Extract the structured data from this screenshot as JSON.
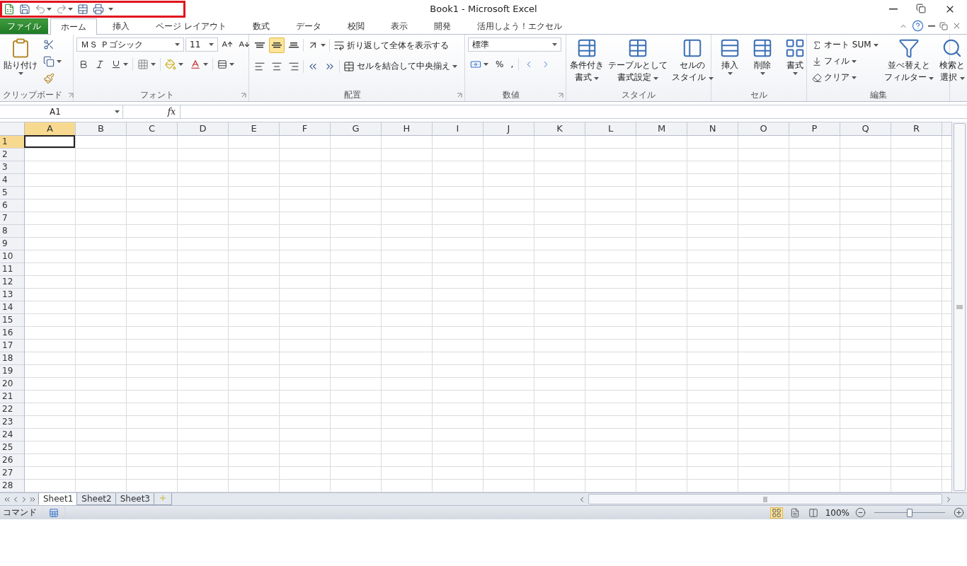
{
  "window": {
    "title": "Book1 - Microsoft Excel"
  },
  "quick_access": {
    "highlighted": true
  },
  "ribbon_tabs": [
    {
      "label": "ファイル",
      "kind": "file",
      "selected": false
    },
    {
      "label": "ホーム",
      "kind": "tab",
      "selected": true
    },
    {
      "label": "挿入",
      "kind": "tab",
      "selected": false
    },
    {
      "label": "ページ レイアウト",
      "kind": "tab",
      "selected": false
    },
    {
      "label": "数式",
      "kind": "tab",
      "selected": false
    },
    {
      "label": "データ",
      "kind": "tab",
      "selected": false
    },
    {
      "label": "校閲",
      "kind": "tab",
      "selected": false
    },
    {
      "label": "表示",
      "kind": "tab",
      "selected": false
    },
    {
      "label": "開発",
      "kind": "tab",
      "selected": false
    },
    {
      "label": "活用しよう！エクセル",
      "kind": "tab",
      "selected": false
    }
  ],
  "clipboard": {
    "label": "クリップボード",
    "paste": "貼り付け"
  },
  "font": {
    "label": "フォント",
    "name": "ＭＳ Ｐゴシック",
    "size": "11"
  },
  "alignment": {
    "label": "配置",
    "vertical": [
      {
        "kind": "top",
        "selected": false
      },
      {
        "kind": "middle",
        "selected": true
      },
      {
        "kind": "bottom",
        "selected": false
      }
    ],
    "wrap": "折り返して全体を表示する",
    "merge": "セルを結合して中央揃え"
  },
  "number": {
    "label": "数値",
    "format": "標準",
    "percent": "%",
    "comma": ","
  },
  "styles": {
    "label": "スタイル",
    "buttons": [
      {
        "kind": "conditional",
        "lines": [
          "条件付き",
          "書式"
        ]
      },
      {
        "kind": "table",
        "lines": [
          "テーブルとして",
          "書式設定"
        ]
      },
      {
        "kind": "cell",
        "lines": [
          "セルの",
          "スタイル"
        ]
      }
    ]
  },
  "cells": {
    "label": "セル",
    "buttons": [
      {
        "kind": "insert",
        "label": "挿入"
      },
      {
        "kind": "delete",
        "label": "削除"
      },
      {
        "kind": "format",
        "label": "書式"
      }
    ]
  },
  "editing": {
    "label": "編集",
    "small": [
      {
        "kind": "sum",
        "label": "オート SUM"
      },
      {
        "kind": "fill",
        "label": "フィル"
      },
      {
        "kind": "clear",
        "label": "クリア"
      }
    ],
    "large": [
      {
        "kind": "sort",
        "lines": [
          "並べ替えと",
          "フィルター"
        ]
      },
      {
        "kind": "find",
        "lines": [
          "検索と",
          "選択"
        ]
      }
    ]
  },
  "formula_bar": {
    "name_box": "A1",
    "function_label": "fx"
  },
  "columns": [
    {
      "label": "A",
      "selected": true
    },
    {
      "label": "B",
      "selected": false
    },
    {
      "label": "C",
      "selected": false
    },
    {
      "label": "D",
      "selected": false
    },
    {
      "label": "E",
      "selected": false
    },
    {
      "label": "F",
      "selected": false
    },
    {
      "label": "G",
      "selected": false
    },
    {
      "label": "H",
      "selected": false
    },
    {
      "label": "I",
      "selected": false
    },
    {
      "label": "J",
      "selected": false
    },
    {
      "label": "K",
      "selected": false
    },
    {
      "label": "L",
      "selected": false
    },
    {
      "label": "M",
      "selected": false
    },
    {
      "label": "N",
      "selected": false
    },
    {
      "label": "O",
      "selected": false
    },
    {
      "label": "P",
      "selected": false
    },
    {
      "label": "Q",
      "selected": false
    },
    {
      "label": "R",
      "selected": false
    }
  ],
  "rows": [
    {
      "label": "1",
      "selected": true
    },
    {
      "label": "2",
      "selected": false
    },
    {
      "label": "3",
      "selected": false
    },
    {
      "label": "4",
      "selected": false
    },
    {
      "label": "5",
      "selected": false
    },
    {
      "label": "6",
      "selected": false
    },
    {
      "label": "7",
      "selected": false
    },
    {
      "label": "8",
      "selected": false
    },
    {
      "label": "9",
      "selected": false
    },
    {
      "label": "10",
      "selected": false
    },
    {
      "label": "11",
      "selected": false
    },
    {
      "label": "12",
      "selected": false
    },
    {
      "label": "13",
      "selected": false
    },
    {
      "label": "14",
      "selected": false
    },
    {
      "label": "15",
      "selected": false
    },
    {
      "label": "16",
      "selected": false
    },
    {
      "label": "17",
      "selected": false
    },
    {
      "label": "18",
      "selected": false
    },
    {
      "label": "19",
      "selected": false
    },
    {
      "label": "20",
      "selected": false
    },
    {
      "label": "21",
      "selected": false
    },
    {
      "label": "22",
      "selected": false
    },
    {
      "label": "23",
      "selected": false
    },
    {
      "label": "24",
      "selected": false
    },
    {
      "label": "25",
      "selected": false
    },
    {
      "label": "26",
      "selected": false
    },
    {
      "label": "27",
      "selected": false
    },
    {
      "label": "28",
      "selected": false
    }
  ],
  "sheet_tabs": [
    {
      "label": "Sheet1",
      "selected": true
    },
    {
      "label": "Sheet2",
      "selected": false
    },
    {
      "label": "Sheet3",
      "selected": false
    }
  ],
  "status_bar": {
    "mode": "コマンド",
    "views": [
      {
        "kind": "normal",
        "selected": true
      },
      {
        "kind": "page_layout",
        "selected": false
      },
      {
        "kind": "page_break",
        "selected": false
      }
    ],
    "zoom": "100%",
    "zoom_slider": {
      "level": 0.5
    }
  }
}
